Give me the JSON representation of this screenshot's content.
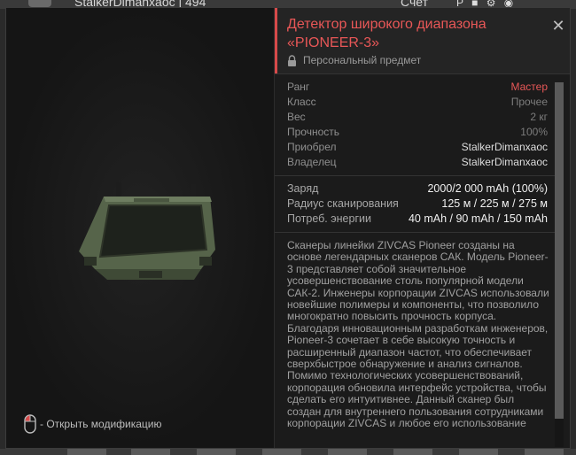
{
  "hud": {
    "player_name": "StalkerDimanxaoc | 494",
    "money_label": "Счет",
    "icons": [
      "player-icon",
      "settings-icon"
    ]
  },
  "item": {
    "title": "Детектор широкого диапазона «PIONEER-3»",
    "personal_label": "Персональный предмет",
    "properties": [
      {
        "key": "Ранг",
        "value": "Мастер"
      },
      {
        "key": "Класс",
        "value": "Прочее"
      },
      {
        "key": "Вес",
        "value": "2 кг"
      },
      {
        "key": "Прочность",
        "value": "100%"
      },
      {
        "key": "Приобрел",
        "value": "StalkerDimanxaoc"
      },
      {
        "key": "Владелец",
        "value": "StalkerDimanxaoc"
      }
    ],
    "stats": [
      {
        "key": "Заряд",
        "value": "2000/2 000 mAh (100%)"
      },
      {
        "key": "Радиус сканирования",
        "value": "125 м / 225 м / 275 м"
      },
      {
        "key": "Потреб. энергии",
        "value": "40 mAh / 90 mAh / 150 mAh"
      }
    ],
    "description": "Сканеры линейки ZIVCAS Pioneer созданы на основе легендарных сканеров САК. Модель Pioneer-3 представляет собой значительное усовершенствование столь популярной модели САК-2. Инженеры корпорации ZIVCAS использовали новейшие полимеры и компоненты, что позволило многократно повысить прочность корпуса. Благодаря инновационным разработкам инженеров, Pioneer-3 сочетает в себе высокую точность и расширенный диапазон частот, что обеспечивает сверхбыстрое обнаружение и анализ сигналов. Помимо технологических усовершенствований, корпорация обновила интерфейс устройства, чтобы сделать его интуитивнее. Данный сканер был создан для внутреннего пользования сотрудниками корпорации ZIVCAS и любое его использование"
  },
  "modification_hint": "- Открыть модификацию",
  "colors": {
    "accent": "#e85757",
    "panel_bg": "#1b1b1b",
    "dialog_bg": "#141414"
  }
}
